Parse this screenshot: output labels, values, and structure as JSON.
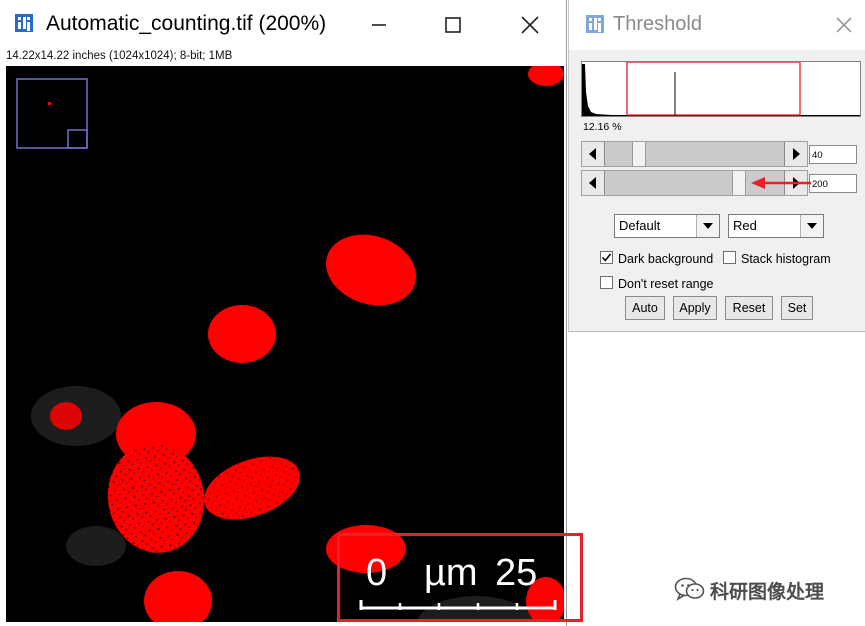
{
  "image_window": {
    "title": "Automatic_counting.tif (200%)",
    "info": "14.22x14.22 inches (1024x1024); 8-bit; 1MB",
    "icons": {
      "app": "imagej-icon",
      "minimize": "minimize-icon",
      "maximize": "maximize-icon",
      "close": "close-icon"
    },
    "scale_bar": {
      "left_label": "0",
      "unit_label": "µm",
      "right_label": "25"
    },
    "colors": {
      "background": "#000000",
      "threshold_overlay": "#ff0000",
      "highlight_box": "#e8202a",
      "navigator": "#7b78d8"
    }
  },
  "threshold_window": {
    "title": "Threshold",
    "percentage": "12.16 %",
    "min_value": "40",
    "max_value": "200",
    "method": "Default",
    "display": "Red",
    "dark_background_label": "Dark background",
    "dark_background_checked": true,
    "stack_histogram_label": "Stack histogram",
    "stack_histogram_checked": false,
    "dont_reset_label": "Don't reset range",
    "dont_reset_checked": false,
    "buttons": {
      "auto": "Auto",
      "apply": "Apply",
      "reset": "Reset",
      "set": "Set"
    },
    "icons": {
      "app": "imagej-icon",
      "close": "close-icon",
      "annotation": "red-arrow-icon"
    }
  },
  "watermark": {
    "text": "科研图像处理",
    "icon": "wechat-icon"
  }
}
